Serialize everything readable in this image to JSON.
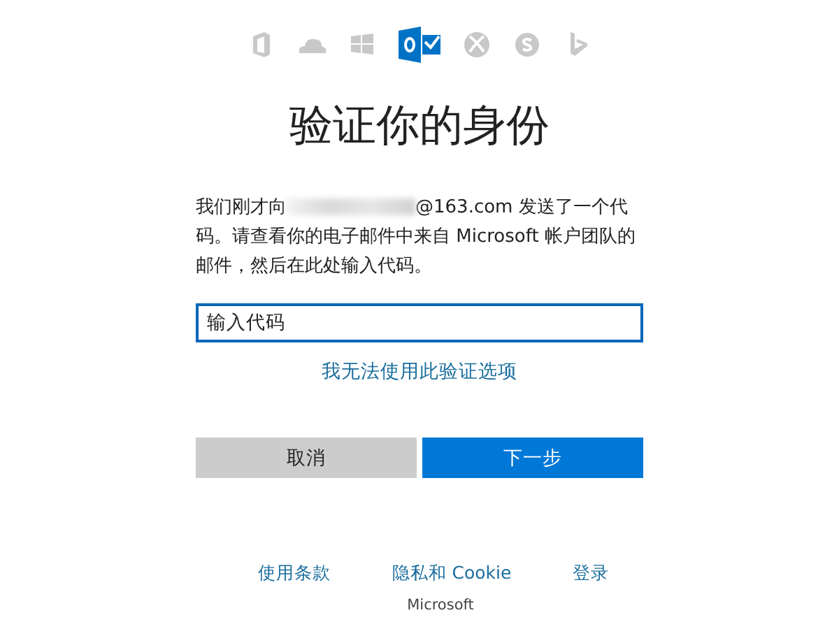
{
  "products": [
    {
      "kind": "office",
      "selected": false
    },
    {
      "kind": "onedrive",
      "selected": false
    },
    {
      "kind": "windows",
      "selected": false
    },
    {
      "kind": "outlook",
      "selected": true
    },
    {
      "kind": "xbox",
      "selected": false
    },
    {
      "kind": "skype",
      "selected": false
    },
    {
      "kind": "bing",
      "selected": false
    }
  ],
  "title": "验证你的身份",
  "message": {
    "before": "我们刚才向",
    "after": "@163.com 发送了一个代码。请查看你的电子邮件中来自 Microsoft 帐户团队的邮件，然后在此处输入代码。"
  },
  "code_field": {
    "placeholder": "输入代码"
  },
  "alt_link": "我无法使用此验证选项",
  "buttons": [
    {
      "label": "取消",
      "kind": "secondary"
    },
    {
      "label": "下一步",
      "kind": "primary"
    }
  ],
  "footer_links": [
    "使用条款",
    "隐私和 Cookie",
    "登录"
  ],
  "brand": "Microsoft"
}
